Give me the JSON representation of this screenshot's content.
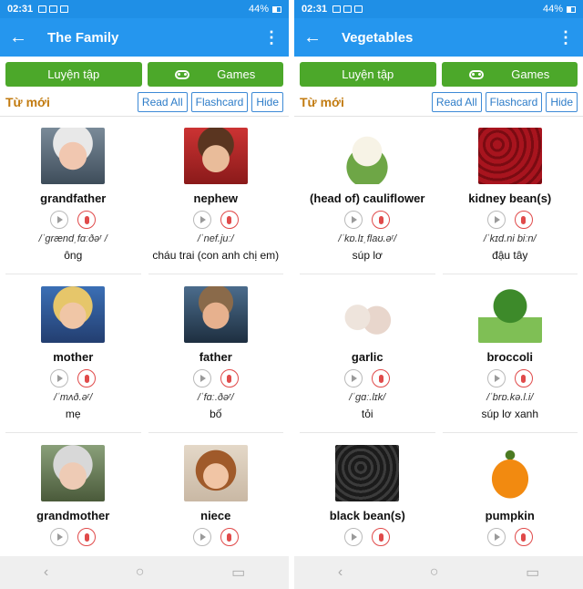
{
  "status": {
    "time": "02:31",
    "battery": "44%"
  },
  "left": {
    "title": "The Family",
    "buttons": {
      "practice": "Luyện tập",
      "games": "Games"
    },
    "section": {
      "label": "Từ mới",
      "read_all": "Read All",
      "flashcard": "Flashcard",
      "hide": "Hide"
    },
    "cards": [
      {
        "word": "grandfather",
        "ipa": "/ˈɡrændˌfɑːðəʳ /",
        "meaning": "ông"
      },
      {
        "word": "nephew",
        "ipa": "/ˈnef.juː/",
        "meaning": "cháu trai (con anh chị em)"
      },
      {
        "word": "mother",
        "ipa": "/ˈmʌð.əʳ/",
        "meaning": "mẹ"
      },
      {
        "word": "father",
        "ipa": "/ˈfɑː.ðəʳ/",
        "meaning": "bố"
      },
      {
        "word": "grandmother",
        "ipa": "",
        "meaning": ""
      },
      {
        "word": "niece",
        "ipa": "",
        "meaning": ""
      }
    ]
  },
  "right": {
    "title": "Vegetables",
    "buttons": {
      "practice": "Luyện tập",
      "games": "Games"
    },
    "section": {
      "label": "Từ mới",
      "read_all": "Read All",
      "flashcard": "Flashcard",
      "hide": "Hide"
    },
    "cards": [
      {
        "word": "(head of) cauliflower",
        "ipa": "/ˈkɒ.lɪˌflaʊ.əʳ/",
        "meaning": "súp lơ"
      },
      {
        "word": "kidney bean(s)",
        "ipa": "/ˈkɪd.ni biːn/",
        "meaning": "đậu tây"
      },
      {
        "word": "garlic",
        "ipa": "/ˈɡɑː.lɪk/",
        "meaning": "tỏi"
      },
      {
        "word": "broccoli",
        "ipa": "/ˈbrɒ.kə.l.i/",
        "meaning": "súp lơ xanh"
      },
      {
        "word": "black bean(s)",
        "ipa": "",
        "meaning": ""
      },
      {
        "word": "pumpkin",
        "ipa": "",
        "meaning": ""
      }
    ]
  },
  "icons": {
    "back": "arrow-left-icon",
    "menu": "more-vert-icon",
    "games": "gamepad-icon",
    "play": "play-icon",
    "mic": "mic-icon"
  },
  "colors": {
    "appbar": "#2596ee",
    "green_button": "#4ca82a",
    "section_label": "#c27b10",
    "outline_button": "#3d8ad6",
    "mic": "#e04a4a"
  }
}
